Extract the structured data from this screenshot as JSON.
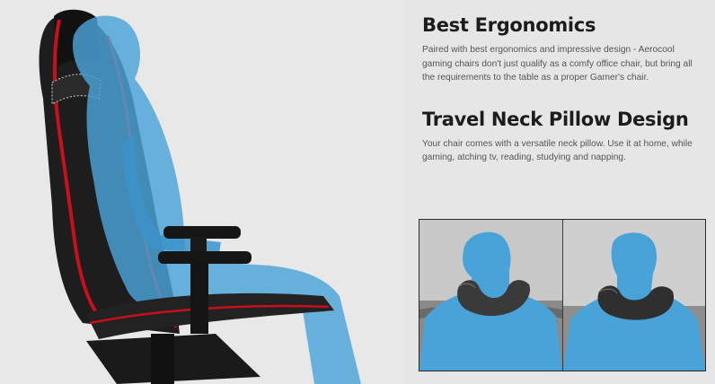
{
  "section1": {
    "title": "Best Ergonomics",
    "body": "Paired with best ergonomics and impressive design - Aerocool gaming chairs don't just qualify as a comfy office chair, but bring all the requirements to the table as a proper Gamer's chair."
  },
  "section2": {
    "title": "Travel Neck Pillow Design",
    "body": "Your chair comes with a versatile neck pillow. Use it at home, while gaming, atching tv, reading, studying and napping."
  },
  "colors": {
    "background": "#e6e6e6",
    "silhouette_blue": "#4aa3d8",
    "chair_black": "#1d1d1d",
    "chair_red_trim": "#c8101c"
  },
  "icons": {
    "hero": "gaming-chair-with-seated-figure",
    "photo_left": "neck-pillow-front-view",
    "photo_right": "neck-pillow-back-view"
  }
}
